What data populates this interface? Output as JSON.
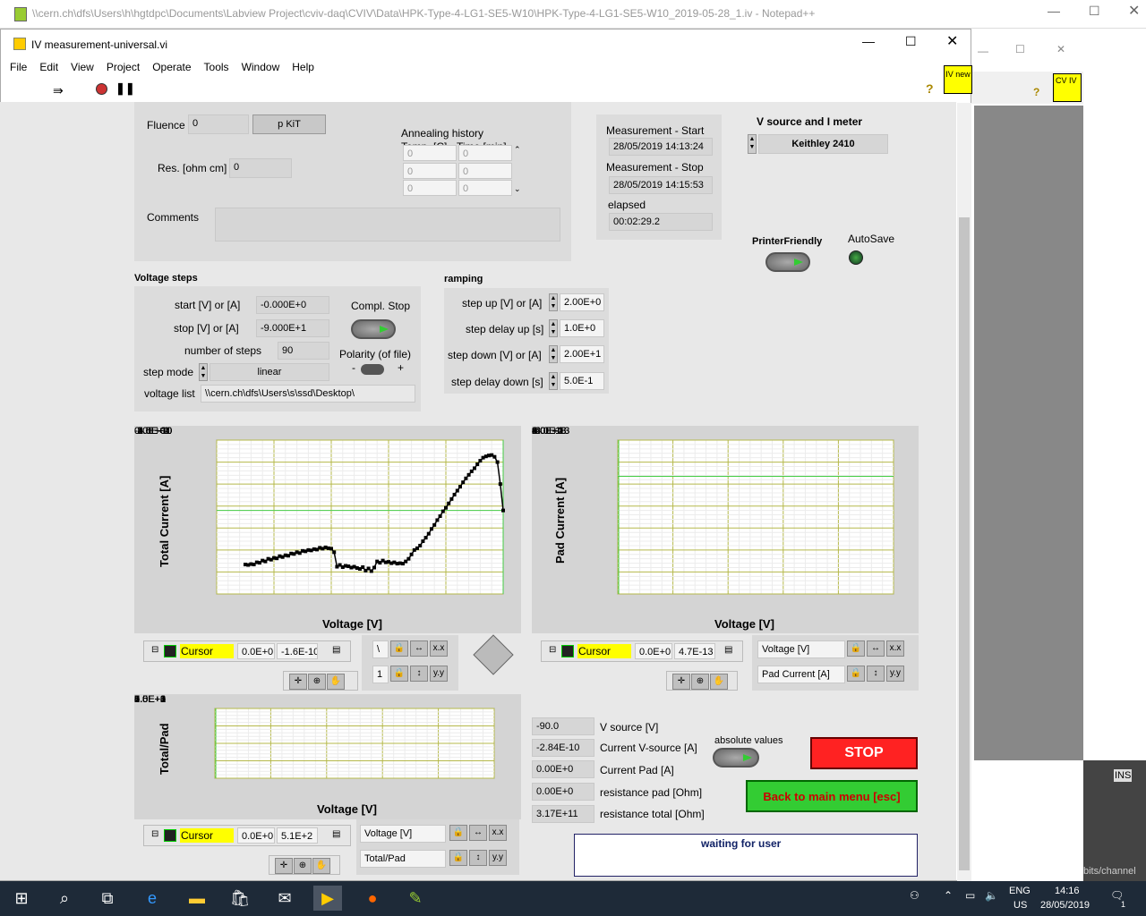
{
  "notepad": {
    "title": "\\\\cern.ch\\dfs\\Users\\h\\hgtdpc\\Documents\\Labview Project\\cviv-daq\\CVIV\\Data\\HPK-Type-4-LG1-SE5-W10\\HPK-Type-4-LG1-SE5-W10_2019-05-28_1.iv - Notepad++",
    "ins": "INS",
    "bits": "bits/channel"
  },
  "bgwin": {
    "cv_icon": "CV IV"
  },
  "window": {
    "title": "IV measurement-universal.vi",
    "icon_text": "IV new"
  },
  "menu": [
    "File",
    "Edit",
    "View",
    "Project",
    "Operate",
    "Tools",
    "Window",
    "Help"
  ],
  "sample": {
    "fluence_label": "Fluence",
    "fluence_value": "0",
    "fluence_unit": "p KiT",
    "res_label": "Res. [ohm cm]",
    "res_value": "0",
    "comments_label": "Comments",
    "comments_value": ""
  },
  "annealing": {
    "title": "Annealing history",
    "col1": "Temp. [C]",
    "col2": "Time [min]",
    "rows": [
      [
        "0",
        "0"
      ],
      [
        "0",
        "0"
      ],
      [
        "0",
        "0"
      ]
    ]
  },
  "times": {
    "start_label": "Measurement - Start",
    "start": "28/05/2019 14:13:24",
    "stop_label": "Measurement - Stop",
    "stop": "28/05/2019 14:15:53",
    "elapsed_label": "elapsed",
    "elapsed": "00:02:29.2"
  },
  "instrument": {
    "label": "V source and I meter",
    "value": "Keithley 2410",
    "printer_label": "PrinterFriendly",
    "autosave_label": "AutoSave"
  },
  "steps": {
    "title": "Voltage steps",
    "start_label": "start [V] or [A]",
    "start": "-0.000E+0",
    "stop_label": "stop [V] or [A]",
    "stop": "-9.000E+1",
    "n_label": "number of steps",
    "n": "90",
    "mode_label": "step mode",
    "mode": "linear",
    "list_label": "voltage list",
    "list": "\\\\cern.ch\\dfs\\Users\\s\\ssd\\Desktop\\",
    "compl_label": "Compl. Stop",
    "polarity_label": "Polarity (of file)",
    "minus": "-",
    "plus": "+"
  },
  "ramping": {
    "title": "ramping",
    "up_label": "step up [V] or [A]",
    "up": "2.00E+0",
    "delay_up_label": "step delay up [s]",
    "delay_up": "1.0E+0",
    "down_label": "step down [V] or [A]",
    "down": "2.00E+1",
    "delay_down_label": "step delay down [s]",
    "delay_down": "5.0E-1"
  },
  "chart_data": [
    {
      "type": "scatter",
      "title": "",
      "xlabel": "Voltage [V]",
      "ylabel": "Total Current [A]",
      "xlim": [
        -100,
        0
      ],
      "ylim": [
        -3.5e-10,
        0
      ],
      "x_ticks": [
        "-1.0E+2",
        "-8.0E+1",
        "-6.0E+1",
        "-4.0E+1",
        "-2.0E+1",
        "0.0E+0"
      ],
      "y_ticks": [
        "0.0E+0",
        "-5.0E-11",
        "-1.0E-10",
        "-1.5E-10",
        "-2.0E-10",
        "-2.5E-10",
        "-3.0E-10",
        "-3.5E-10"
      ],
      "x": [
        -90,
        -89,
        -88,
        -87,
        -86,
        -85,
        -84,
        -83,
        -82,
        -81,
        -80,
        -79,
        -78,
        -77,
        -76,
        -75,
        -74,
        -73,
        -72,
        -71,
        -70,
        -69,
        -68,
        -67,
        -66,
        -65,
        -64,
        -63,
        -62,
        -61,
        -60,
        -59,
        -58,
        -57,
        -56,
        -55,
        -54,
        -53,
        -52,
        -51,
        -50,
        -49,
        -48,
        -47,
        -46,
        -45,
        -44,
        -43,
        -42,
        -41,
        -40,
        -39,
        -38,
        -37,
        -36,
        -35,
        -34,
        -33,
        -32,
        -31,
        -30,
        -29,
        -28,
        -27,
        -26,
        -25,
        -24,
        -23,
        -22,
        -21,
        -20,
        -19,
        -18,
        -17,
        -16,
        -15,
        -14,
        -13,
        -12,
        -11,
        -10,
        -9,
        -8,
        -7,
        -6,
        -5,
        -4,
        -3,
        -2,
        -1,
        0
      ],
      "y": [
        -2.83e-10,
        -2.84e-10,
        -2.82e-10,
        -2.83e-10,
        -2.78e-10,
        -2.79e-10,
        -2.74e-10,
        -2.76e-10,
        -2.7e-10,
        -2.72e-10,
        -2.68e-10,
        -2.69e-10,
        -2.64e-10,
        -2.66e-10,
        -2.62e-10,
        -2.63e-10,
        -2.58e-10,
        -2.59e-10,
        -2.55e-10,
        -2.57e-10,
        -2.52e-10,
        -2.53e-10,
        -2.5e-10,
        -2.51e-10,
        -2.48e-10,
        -2.49e-10,
        -2.45e-10,
        -2.47e-10,
        -2.44e-10,
        -2.46e-10,
        -2.47e-10,
        -2.55e-10,
        -2.88e-10,
        -2.84e-10,
        -2.89e-10,
        -2.86e-10,
        -2.87e-10,
        -2.9e-10,
        -2.88e-10,
        -2.91e-10,
        -2.93e-10,
        -2.89e-10,
        -2.97e-10,
        -2.92e-10,
        -2.98e-10,
        -2.9e-10,
        -2.76e-10,
        -2.79e-10,
        -2.74e-10,
        -2.78e-10,
        -2.77e-10,
        -2.8e-10,
        -2.78e-10,
        -2.81e-10,
        -2.8e-10,
        -2.81e-10,
        -2.76e-10,
        -2.7e-10,
        -2.6e-10,
        -2.5e-10,
        -2.46e-10,
        -2.4e-10,
        -2.3e-10,
        -2.22e-10,
        -2.13e-10,
        -2.02e-10,
        -1.93e-10,
        -1.82e-10,
        -1.73e-10,
        -1.62e-10,
        -1.54e-10,
        -1.44e-10,
        -1.34e-10,
        -1.24e-10,
        -1.15e-10,
        -1.06e-10,
        -9.6e-11,
        -8.7e-11,
        -7.9e-11,
        -7.1e-11,
        -6.4e-11,
        -5.5e-11,
        -4.7e-11,
        -4e-11,
        -3.7e-11,
        -3.5e-11,
        -3.4e-11,
        -3.8e-11,
        -5e-11,
        -1e-10,
        -1.6e-10
      ]
    },
    {
      "type": "line",
      "title": "",
      "xlabel": "Voltage [V]",
      "ylabel": "Pad Current [A]",
      "xlim": [
        0,
        100
      ],
      "ylim": [
        -6e-13,
        8e-13
      ],
      "x_ticks": [
        "0.0E+0",
        "2.0E+1",
        "4.0E+1",
        "6.0E+1",
        "8.0E+1",
        "1.0E+2"
      ],
      "y_ticks": [
        "8.0E-13",
        "6.0E-13",
        "4.0E-13",
        "2.0E-13",
        "0.0E+0",
        "-2.0E-13",
        "-4.0E-13",
        "-6.0E-13"
      ],
      "series": []
    },
    {
      "type": "line",
      "title": "",
      "xlabel": "Voltage [V]",
      "ylabel": "Total/Pad",
      "xlim": [
        0,
        100
      ],
      "ylim": [
        0,
        10000
      ],
      "x_ticks": [
        "0.0E+0",
        "2.0E+1",
        "4.0E+1",
        "6.0E+1",
        "8.0E+1",
        "1.0E+2"
      ],
      "y_ticks": [
        "1.0E+4",
        "7.5E+3",
        "5.0E+3",
        "2.5E+3",
        "0.0E+0"
      ],
      "series": []
    }
  ],
  "cursors": {
    "c1_name": "Cursor",
    "c1_x": "0.0E+0",
    "c1_y": "-1.6E-10",
    "c2_name": "Cursor",
    "c2_x": "0.0E+0",
    "c2_y": "4.7E-13",
    "c3_name": "Cursor",
    "c3_x": "0.0E+0",
    "c3_y": "5.1E+2",
    "p1a": "\\",
    "p1b": "1",
    "p2a": "Voltage [V]",
    "p2b": "Pad Current [A]",
    "p3a": "Voltage [V]",
    "p3b": "Total/Pad"
  },
  "readouts": [
    {
      "value": "-90.0",
      "label": "V source [V]"
    },
    {
      "value": "-2.84E-10",
      "label": "Current V-source [A]"
    },
    {
      "value": "0.00E+0",
      "label": "Current Pad  [A]"
    },
    {
      "value": "0.00E+0",
      "label": "resistance pad  [Ohm]"
    },
    {
      "value": "3.17E+11",
      "label": "resistance total  [Ohm]"
    }
  ],
  "controls": {
    "absolute_label": "absolute values",
    "stop_label": "STOP",
    "back_label": "Back to main menu [esc]",
    "status": "waiting for user"
  },
  "taskbar": {
    "lang1": "ENG",
    "lang2": "US",
    "time": "14:16",
    "date": "28/05/2019",
    "notif_count": "1"
  }
}
